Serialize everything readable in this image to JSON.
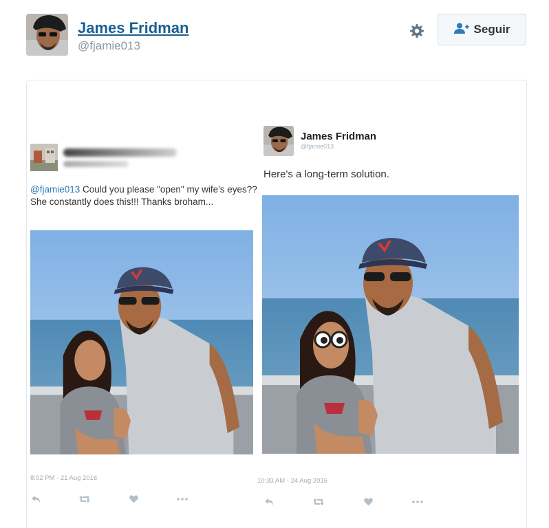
{
  "header": {
    "display_name": "James Fridman",
    "handle": "@fjamie013",
    "follow_label": "Seguir"
  },
  "reply_tweet": {
    "mention": "@fjamie013",
    "text": " Could you please \"open\" my wife's eyes?? She constantly does this!!! Thanks broham...",
    "timestamp": "8:02 PM - 21 Aug 2016"
  },
  "answer_tweet": {
    "display_name": "James Fridman",
    "handle": "@fjamie013",
    "text": "Here's a long-term solution.",
    "timestamp": "10:33 AM - 24 Aug 2016"
  },
  "icons": [
    "gear-icon",
    "add-user-icon",
    "reply-icon",
    "retweet-icon",
    "like-icon",
    "more-icon"
  ],
  "colors": {
    "name_link": "#1b5f93",
    "mention": "#2b7bb9",
    "muted": "#8899a6",
    "follow_accent": "#2b7bb9"
  }
}
